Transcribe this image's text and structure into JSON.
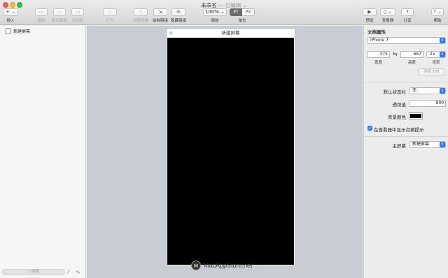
{
  "window": {
    "title": "未命名",
    "subtitle": " — 已编辑 ⌄"
  },
  "toolbar": {
    "insert": "插入",
    "edit": "编辑",
    "cancel_edit": "取消编辑",
    "move_to": "添加组",
    "action": "行为",
    "create_link": "创建链接",
    "draw_link": "绘制链接",
    "hide_link": "隐藏链接",
    "zoom_value": "100%",
    "zoom_label": "缩放",
    "unit_pt": "PT",
    "unit_px": "PX",
    "unit_label": "单位",
    "preview": "预览",
    "viewer": "查看器",
    "share": "分享",
    "help": "帮助"
  },
  "sidebar": {
    "screens": [
      "新建屏幕"
    ],
    "search_placeholder": "搜索"
  },
  "canvas": {
    "screen_title": "新建屏幕",
    "watermark": "MacAppStore.net"
  },
  "inspector": {
    "title": "文档属性",
    "device": "iPhone 7",
    "width": "375",
    "height": "667",
    "scale": "2x",
    "width_label": "宽度",
    "height_label": "高度",
    "scale_label": "倍率",
    "update_button": "更新文档",
    "status_bar_label": "默认状态栏",
    "status_bar_value": "无",
    "opacity_label": "透视值",
    "opacity_value": "800",
    "bg_color_label": "背景颜色",
    "bg_color": "#000000",
    "show_tap_hints": "在查看器中显示点按提示",
    "main_screen_label": "主屏幕",
    "main_screen_value": "新建屏幕"
  }
}
